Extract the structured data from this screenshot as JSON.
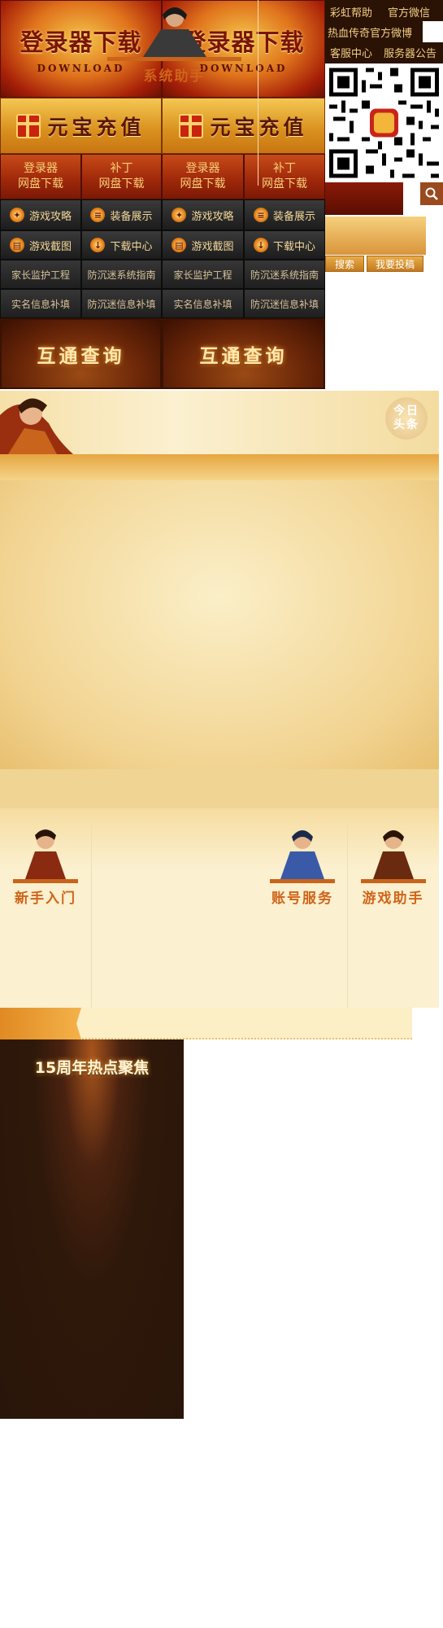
{
  "download": {
    "title": "登录器下载",
    "subtitle": "DOWNLOAD"
  },
  "recharge": {
    "label": "元宝充值"
  },
  "pan_links": [
    "登录器\n网盘下载",
    "补丁\n网盘下载"
  ],
  "nav_row1": [
    "游戏攻略",
    "装备展示"
  ],
  "nav_row2": [
    "游戏截图",
    "下载中心"
  ],
  "nav_row3": [
    "家长监护工程",
    "防沉迷系统指南"
  ],
  "nav_row4": [
    "实名信息补填",
    "防沉迷信息补填"
  ],
  "query": {
    "label": "互通查询"
  },
  "top_links": {
    "row1": [
      "彩虹帮助",
      "官方微信"
    ],
    "row2": [
      "热血传奇官方微博"
    ],
    "row3": [
      "客服中心",
      "服务器公告"
    ]
  },
  "search": {
    "button": "搜索",
    "submit": "我要投稿"
  },
  "news": {
    "badge": "今日头条"
  },
  "services": [
    "新手入门",
    "系统助手",
    "账号服务",
    "游戏助手"
  ],
  "hotspot": {
    "title": "15周年热点聚焦"
  },
  "icons": {
    "search": "search-icon",
    "qr": "qr-code",
    "gift": "gift-icon"
  }
}
